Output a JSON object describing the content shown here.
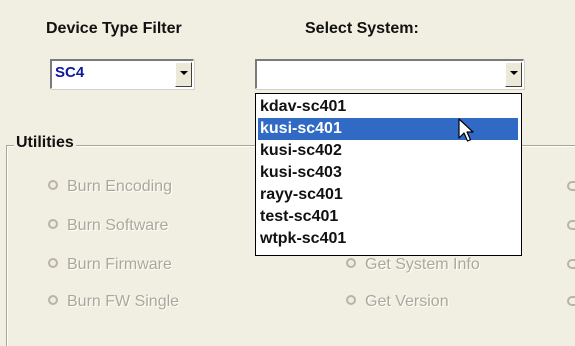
{
  "device_type_filter": {
    "label": "Device Type Filter",
    "selected": "SC4"
  },
  "select_system": {
    "label": "Select System:",
    "selected": "",
    "options": [
      "kdav-sc401",
      "kusi-sc401",
      "kusi-sc402",
      "kusi-sc403",
      "rayy-sc401",
      "test-sc401",
      "wtpk-sc401"
    ],
    "highlighted_index": 1
  },
  "utilities": {
    "title": "Utilities",
    "left_radios": [
      "Burn Encoding",
      "Burn Software",
      "Burn Firmware",
      "Burn FW Single"
    ],
    "right_radios": [
      "Get System Info",
      "Get Version"
    ]
  },
  "colors": {
    "background": "#f1efe2",
    "highlight": "#316ac5",
    "disabled_text": "#aca899",
    "combo_value": "#0a1a9c"
  }
}
